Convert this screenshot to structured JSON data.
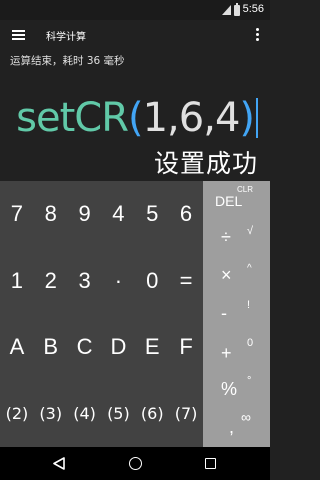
{
  "status_bar": {
    "time": "5:56",
    "icons": [
      "signal-icon",
      "battery-icon"
    ]
  },
  "app_bar": {
    "title": "科学计算",
    "icons": [
      "menu-icon",
      "more-vert-icon"
    ]
  },
  "display": {
    "info": "运算结束，耗时 36 毫秒",
    "expression": {
      "function": "setCR",
      "open_paren": "(",
      "args": "1,6,4",
      "close_paren": ")"
    },
    "result": "设置成功"
  },
  "keypad": {
    "rows": [
      [
        "7",
        "8",
        "9",
        "4",
        "5",
        "6"
      ],
      [
        "1",
        "2",
        "3",
        "·",
        "0",
        "="
      ],
      [
        "A",
        "B",
        "C",
        "D",
        "E",
        "F"
      ],
      [
        "(2)",
        "(3)",
        "(4)",
        "(5)",
        "(6)",
        "(7)"
      ]
    ]
  },
  "operators": [
    {
      "main": "DEL",
      "secondary": "CLR"
    },
    {
      "main": "÷",
      "secondary": "√"
    },
    {
      "main": "×",
      "secondary": "^"
    },
    {
      "main": "-",
      "secondary": "!"
    },
    {
      "main": "+",
      "secondary": "0"
    },
    {
      "main": "%",
      "secondary": "°"
    },
    {
      "main": ",",
      "secondary": "∞"
    }
  ],
  "colors": {
    "function": "#61c9a8",
    "paren": "#42a5f5",
    "keypad_bg": "#424242",
    "ops_bg": "#9e9e9e"
  }
}
